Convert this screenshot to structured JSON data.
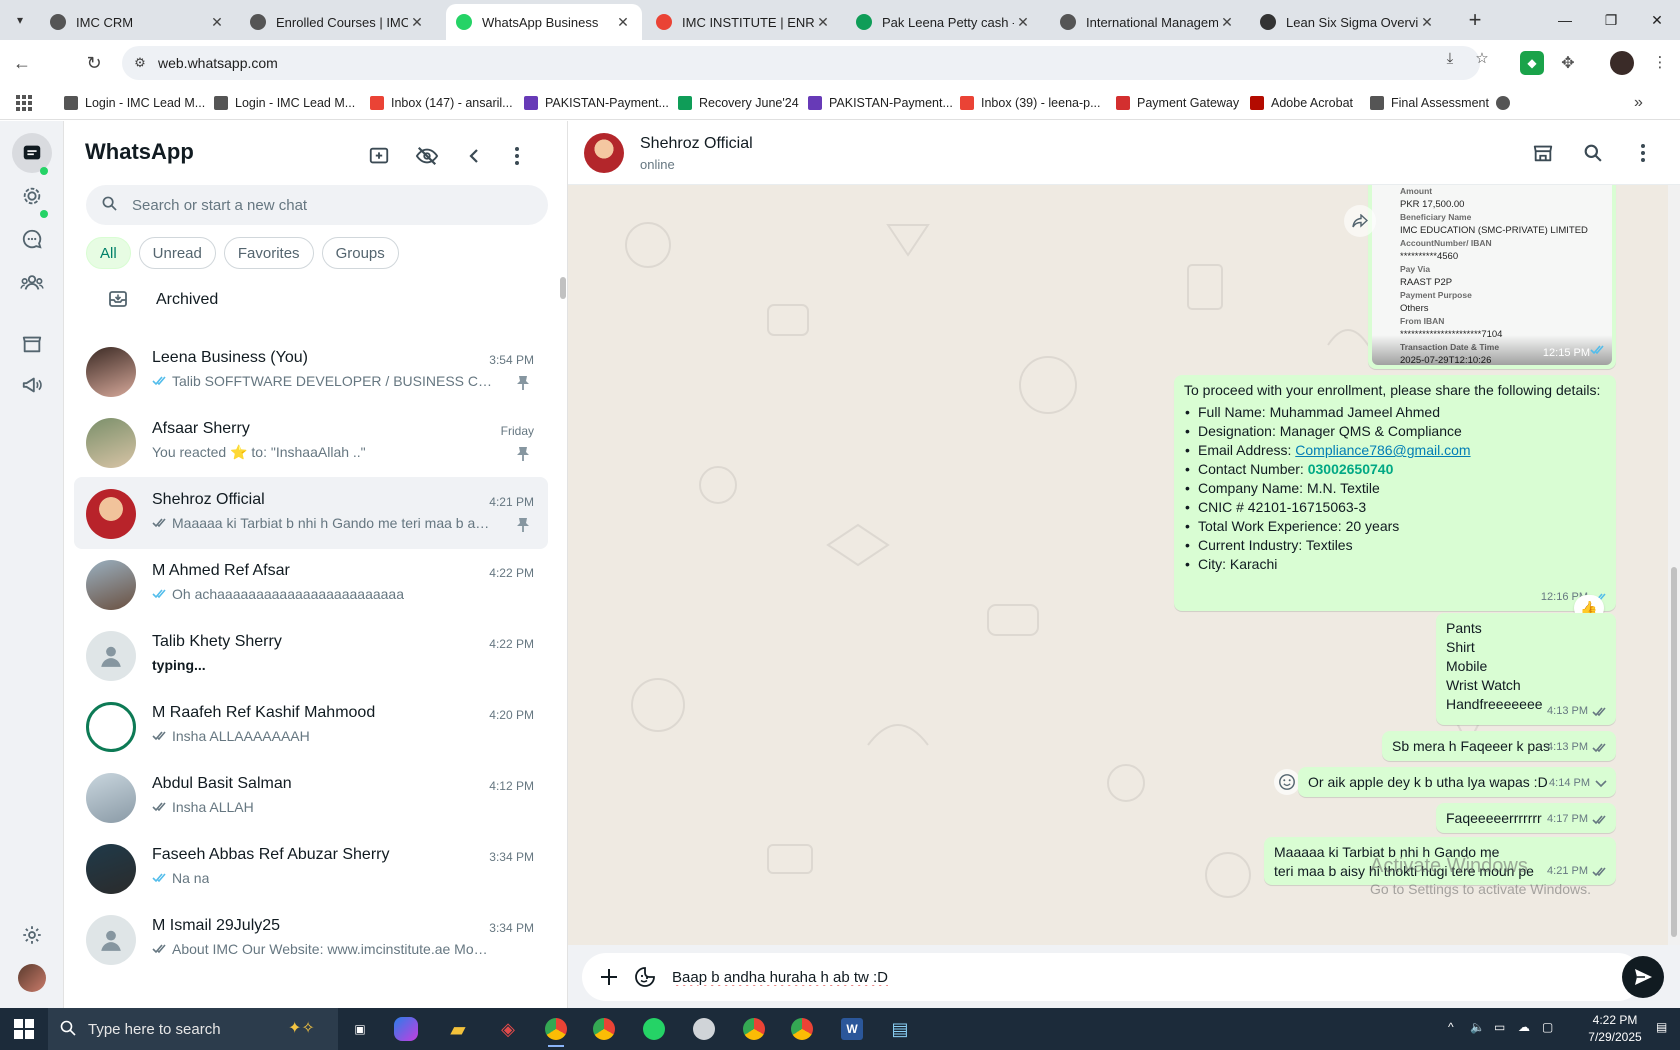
{
  "browser": {
    "tabs": [
      {
        "title": "IMC CRM",
        "favicon": "imc-lead-icon",
        "active": false
      },
      {
        "title": "Enrolled Courses | IMC C",
        "favicon": "imc-lead-icon",
        "active": false
      },
      {
        "title": "WhatsApp Business",
        "favicon": "whatsapp-icon",
        "active": true
      },
      {
        "title": "IMC INSTITUTE | ENROLL",
        "favicon": "gmail-icon",
        "active": false
      },
      {
        "title": "Pak Leena Petty cash - Go",
        "favicon": "sheets-icon",
        "active": false
      },
      {
        "title": "International Manageme",
        "favicon": "imc-lead-icon",
        "active": false
      },
      {
        "title": "Lean Six Sigma Overview",
        "favicon": "chatgpt-icon",
        "active": false
      }
    ],
    "url": "web.whatsapp.com",
    "bookmarks": [
      {
        "label": "Login - IMC Lead M...",
        "icon": "imc-lead-icon"
      },
      {
        "label": "Login - IMC Lead M...",
        "icon": "imc-lead-icon"
      },
      {
        "label": "Inbox (147) - ansaril...",
        "icon": "gmail-icon"
      },
      {
        "label": "PAKISTAN-Payment...",
        "icon": "forms-icon"
      },
      {
        "label": "Recovery June'24",
        "icon": "sheets-icon"
      },
      {
        "label": "PAKISTAN-Payment...",
        "icon": "forms-icon"
      },
      {
        "label": "Inbox (39) - leena-p...",
        "icon": "gmail-icon"
      },
      {
        "label": "Payment Gateway",
        "icon": "alert-icon"
      },
      {
        "label": "Adobe Acrobat",
        "icon": "acrobat-icon"
      },
      {
        "label": "Final Assessment",
        "icon": "imc-lead-icon"
      }
    ]
  },
  "sidebar": {
    "title": "WhatsApp",
    "search_placeholder": "Search or start a new chat",
    "filters": [
      "All",
      "Unread",
      "Favorites",
      "Groups"
    ],
    "archived_label": "Archived",
    "chats": [
      {
        "name": "Leena Business (You)",
        "time": "3:54 PM",
        "preview": "Talib SOFFTWARE DEVELOPER / BUSINESS CONSULTANT",
        "ticks": "blue",
        "pinned": true
      },
      {
        "name": "Afsaar Sherry",
        "time": "Friday",
        "preview": "You reacted ⭐ to: \"InshaaAllah ..\"",
        "ticks": "none",
        "pinned": true
      },
      {
        "name": "Shehroz Official",
        "time": "4:21 PM",
        "preview": "Maaaaa ki Tarbiat b nhi h Gando me teri maa b aisy hi thokti hugi",
        "ticks": "gray",
        "pinned": true,
        "selected": true
      },
      {
        "name": "M Ahmed Ref Afsar",
        "time": "4:22 PM",
        "preview": "Oh achaaaaaaaaaaaaaaaaaaaaaaaa",
        "ticks": "blue",
        "pinned": false
      },
      {
        "name": "Talib Khety Sherry",
        "time": "4:22 PM",
        "preview": "typing...",
        "ticks": "none",
        "pinned": false,
        "typing": true
      },
      {
        "name": "M Raafeh Ref Kashif Mahmood",
        "time": "4:20 PM",
        "preview": "Insha ALLAAAAAAAH",
        "ticks": "gray",
        "pinned": false
      },
      {
        "name": "Abdul Basit Salman",
        "time": "4:12 PM",
        "preview": "Insha ALLAH",
        "ticks": "gray",
        "pinned": false
      },
      {
        "name": "Faseeh Abbas Ref Abuzar Sherry",
        "time": "3:34 PM",
        "preview": "Na na",
        "ticks": "blue",
        "pinned": false
      },
      {
        "name": "M Ismail 29July25",
        "time": "3:34 PM",
        "preview": "About IMC Our Website: www.imcinstitute.ae More Info...",
        "ticks": "gray",
        "pinned": false
      }
    ]
  },
  "conversation": {
    "contact_name": "Shehroz Official",
    "status": "online",
    "receipt": {
      "lines": [
        {
          "label": "Amount",
          "value": "PKR 17,500.00"
        },
        {
          "label": "Beneficiary Name",
          "value": "IMC EDUCATION (SMC-PRIVATE) LIMITED"
        },
        {
          "label": "AccountNumber/ IBAN",
          "value": "**********4560"
        },
        {
          "label": "Pay Via",
          "value": "RAAST P2P"
        },
        {
          "label": "Payment Purpose",
          "value": "Others"
        },
        {
          "label": "From IBAN",
          "value": "**********************7104"
        },
        {
          "label": "Transaction Date & Time",
          "value": "2025-07-29T12:10:26"
        }
      ],
      "time": "12:15 PM"
    },
    "details_message": {
      "intro": "To proceed with your enrollment, please share the following details:",
      "items": [
        {
          "label": "Full Name: ",
          "value": "Muhammad Jameel Ahmed",
          "style": "plain"
        },
        {
          "label": "Designation: ",
          "value": "Manager QMS & Compliance",
          "style": "plain"
        },
        {
          "label": "Email Address: ",
          "value": "Compliance786@gmail.com",
          "style": "link"
        },
        {
          "label": "Contact Number: ",
          "value": "03002650740",
          "style": "phone"
        },
        {
          "label": "Company Name: ",
          "value": "M.N. Textile",
          "style": "plain"
        },
        {
          "label": "CNIC # ",
          "value": "42101-16715063-3",
          "style": "plain"
        },
        {
          "label": "Total Work Experience: ",
          "value": "20 years",
          "style": "plain"
        },
        {
          "label": "Current Industry: ",
          "value": "Textiles",
          "style": "plain"
        },
        {
          "label": "City: ",
          "value": "Karachi",
          "style": "plain"
        }
      ],
      "time": "12:16 PM",
      "reaction": "👍"
    },
    "messages": [
      {
        "text": "Pants\nShirt\nMobile\nWrist Watch\nHandfreeeeeee",
        "time": "4:13 PM"
      },
      {
        "text": "Sb mera h Faqeeer k pas",
        "time": "4:13 PM"
      },
      {
        "text": "Or aik apple dey k b utha lya wapas :D",
        "time": "4:14 PM"
      },
      {
        "text": "Faqeeeeerrrrrrr",
        "time": "4:17 PM"
      },
      {
        "text": "Maaaaa ki Tarbiat b nhi h Gando me\nteri maa b aisy hi thokti hugi tere moun pe",
        "time": "4:21 PM"
      }
    ],
    "composer_value": "Baap b andha huraha h ab tw :D"
  },
  "watermark": {
    "line1": "Activate Windows",
    "line2": "Go to Settings to activate Windows."
  },
  "taskbar": {
    "search_placeholder": "Type here to search",
    "time": "4:22 PM",
    "date": "7/29/2025"
  },
  "colors": {
    "whatsapp_green": "#00a884",
    "outgoing_bubble": "#d9fdd3",
    "chat_background": "#efeae2",
    "read_tick_blue": "#53bdeb"
  }
}
